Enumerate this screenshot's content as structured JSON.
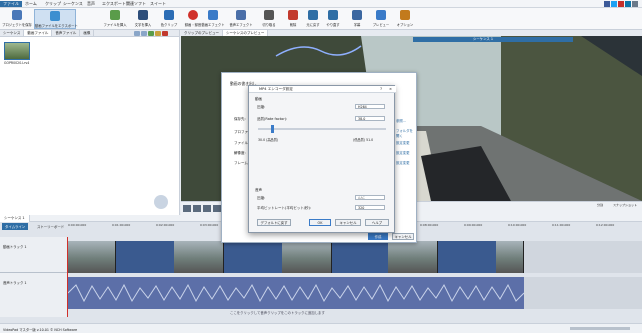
{
  "menu": {
    "items": [
      "ファイル",
      "ホーム",
      "クリップ",
      "シーケンス",
      "音声",
      "エクスポート",
      "関連ソフト",
      "スイート"
    ]
  },
  "toolbar": {
    "buttons": [
      "プロジェクトを保存",
      "動画ファイルをエクスポート",
      "ファイルを挿入",
      "文字を挿入",
      "色クリップ",
      "録画・録音",
      "動画エフェクト",
      "音声エフェクト",
      "切り取る",
      "削除",
      "元に戻す",
      "やり直す",
      "字幕",
      "プレビュー",
      "オプション"
    ]
  },
  "leftpane": {
    "tabs": [
      "シーケンス",
      "動画ファイル",
      "音声ファイル",
      "画像"
    ],
    "file_name": "GOPR0020.Lrv4"
  },
  "preview": {
    "tabs": [
      "クリップのプレビュー",
      "シーケンスのプレビュー"
    ],
    "seq_title": "シーケンス 1",
    "time": "0:00:00.000",
    "buttons": [
      "分割",
      "スナップショット"
    ]
  },
  "timeline": {
    "seq_tab": "シーケンス 1",
    "modes": [
      "タイムライン",
      "ストーリーボード"
    ],
    "ticks": [
      "0:00:00.000",
      "0:01:00.000",
      "0:02:00.000",
      "0:03:00.000",
      "0:04:00.000",
      "0:05:00.000",
      "0:06:00.000",
      "0:07:00.000",
      "0:08:00.000",
      "0:09:00.000",
      "0:10:00.000",
      "0:11:00.000",
      "0:12:00.000",
      "0:13:00.000"
    ],
    "track_labels": [
      "動画トラック 1",
      "音声トラック 1"
    ],
    "hint": "ここをクリックして音声クリップをこのトラックに追加します"
  },
  "status": {
    "left": "VideoPad マスター版 v.10.01 © NCH Software"
  },
  "dialog": {
    "title": "MP4 エンコーダ設定",
    "close": "×",
    "help": "?",
    "video_section": "動画",
    "codec_label": "圧縮:",
    "codec_value": "H264",
    "quality_label": "品質(Rate factor):",
    "quality_value": "38.0",
    "quality_range": "30.0 (高品質)",
    "quality_range_right": "(低品質) 51.0",
    "audio_section": "音声",
    "audio_codec_label": "圧縮:",
    "audio_codec_value": "AAC",
    "bitrate_label": "平均ビットレート(平均ビット/秒):",
    "bitrate_value": "320",
    "buttons": {
      "defaults": "デフォルトに戻す",
      "ok": "OK",
      "cancel": "キャンセル",
      "help": "ヘルプ"
    }
  },
  "dialog_back": {
    "title": "動画の書き出し",
    "labels": [
      "保存先:",
      "プロファ",
      "ファイル",
      "解像度:",
      "フレーム"
    ],
    "links": [
      "参照...",
      "フォルダを開く",
      "設定変更",
      "設定変更",
      "設定変更"
    ],
    "buttons": {
      "create": "作成",
      "cancel": "キャンセル"
    }
  }
}
